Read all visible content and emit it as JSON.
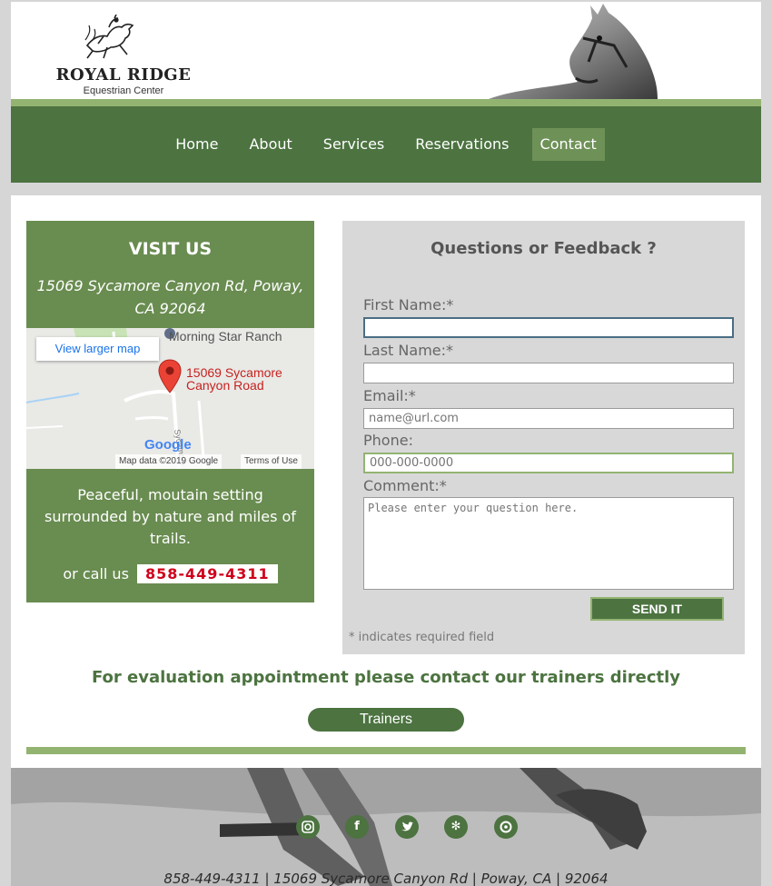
{
  "brand": {
    "name": "ROYAL RIDGE",
    "subtitle": "Equestrian Center"
  },
  "nav": {
    "items": [
      {
        "label": "Home"
      },
      {
        "label": "About"
      },
      {
        "label": "Services"
      },
      {
        "label": "Reservations"
      },
      {
        "label": "Contact",
        "active": true
      }
    ]
  },
  "visit": {
    "title": "VISIT US",
    "address": "15069 Sycamore Canyon Rd, Poway, CA 92064",
    "description": "Peaceful, moutain setting surrounded by nature and miles of trails.",
    "call_prefix": "or call us",
    "phone": "858-449-4311"
  },
  "map": {
    "larger_map_label": "View larger map",
    "nearby_place": "Morning Star Ranch",
    "pin_label_line1": "15069 Sycamore",
    "pin_label_line2": "Canyon Road",
    "google_logo": "Google",
    "attribution": "Map data ©2019 Google",
    "terms": "Terms of Use"
  },
  "form": {
    "title": "Questions or Feedback ?",
    "first_name_label": "First Name:*",
    "first_name_value": "",
    "last_name_label": "Last Name:*",
    "last_name_value": "",
    "email_label": "Email:*",
    "email_placeholder": "name@url.com",
    "phone_label": "Phone:",
    "phone_placeholder": "000-000-0000",
    "comment_label": "Comment:*",
    "comment_placeholder": "Please enter your question here.",
    "submit_label": "SEND IT",
    "required_note": "* indicates required field"
  },
  "evaluation": {
    "text": "For evaluation appointment please contact our trainers directly",
    "button_label": "Trainers"
  },
  "footer": {
    "social_icons": [
      "instagram-icon",
      "facebook-icon",
      "twitter-icon",
      "yelp-icon",
      "tripadvisor-icon"
    ],
    "contact_line": "858-449-4311 | 15069 Sycamore Canyon Rd | Poway, CA | 92064"
  },
  "colors": {
    "dark_green": "#4c7340",
    "medium_green": "#698c50",
    "light_green": "#93b471",
    "active_nav": "#6e9157",
    "phone_red": "#d0021b"
  }
}
